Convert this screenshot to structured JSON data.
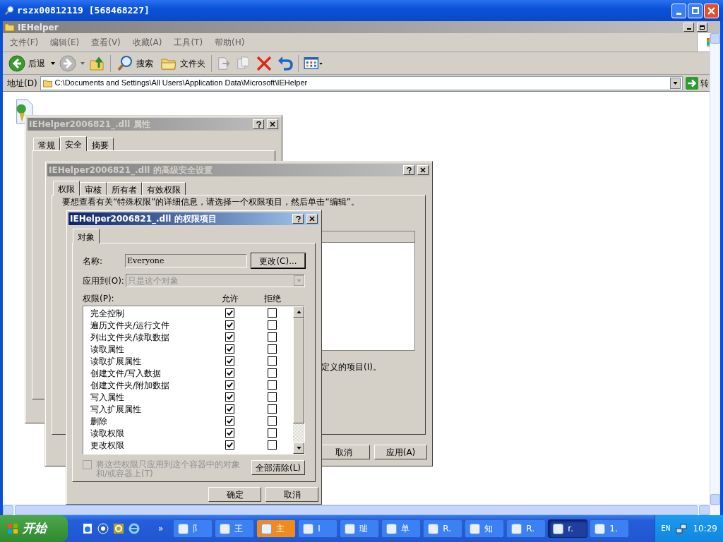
{
  "window": {
    "title": "rszx00812119 [568468227]"
  },
  "explorer": {
    "title": "IEHelper",
    "menu": [
      "文件(F)",
      "编辑(E)",
      "查看(V)",
      "收藏(A)",
      "工具(T)",
      "帮助(H)"
    ],
    "toolbar": [
      {
        "kind": "back",
        "label": "后退"
      },
      {
        "kind": "forward"
      },
      {
        "kind": "up"
      },
      {
        "kind": "search",
        "label": "搜索"
      },
      {
        "kind": "folders",
        "label": "文件夹"
      },
      {
        "kind": "move"
      },
      {
        "kind": "copy"
      },
      {
        "kind": "delete"
      },
      {
        "kind": "undo"
      },
      {
        "kind": "views"
      }
    ],
    "address": {
      "label": "地址(D)",
      "value": "C:\\Documents and Settings\\All Users\\Application Data\\Microsoft\\IEHelper",
      "go": "转"
    }
  },
  "properties_dialog": {
    "title": "IEHelper2006821_.dll 属性",
    "active": false,
    "tabs": [
      {
        "label": "常规",
        "selected": false
      },
      {
        "label": "安全",
        "selected": true
      },
      {
        "label": "摘要",
        "selected": false
      }
    ]
  },
  "advanced_dialog": {
    "title": "IEHelper2006821_.dll 的高级安全设置",
    "active": false,
    "tabs": [
      {
        "label": "权限",
        "selected": true
      },
      {
        "label": "审核",
        "selected": false
      },
      {
        "label": "所有者",
        "selected": false
      },
      {
        "label": "有效权限",
        "selected": false
      }
    ],
    "hint": "要想查看有关“特殊权限”的详细信息，请选择一个权限项目，然后单击“编辑”。",
    "note": "定义的项目(I)。",
    "buttons": [
      "取消",
      "应用(A)"
    ]
  },
  "entry_dialog": {
    "title": "IEHelper2006821_.dll 的权限项目",
    "active": true,
    "tabs": [
      {
        "label": "对象",
        "selected": true
      }
    ],
    "name_label": "名称:",
    "name_value": "Everyone",
    "change_button": "更改(C)...",
    "apply_label": "应用到(O):",
    "apply_value": "只是这个对象",
    "apply_disabled": true,
    "permissions_label": "权限(P):",
    "allow_header": "允许",
    "deny_header": "拒绝",
    "rows": [
      {
        "name": "完全控制",
        "allow": true,
        "deny": false
      },
      {
        "name": "遍历文件夹/运行文件",
        "allow": true,
        "deny": false
      },
      {
        "name": "列出文件夹/读取数据",
        "allow": true,
        "deny": false
      },
      {
        "name": "读取属性",
        "allow": true,
        "deny": false
      },
      {
        "name": "读取扩展属性",
        "allow": true,
        "deny": false
      },
      {
        "name": "创建文件/写入数据",
        "allow": true,
        "deny": false
      },
      {
        "name": "创建文件夹/附加数据",
        "allow": true,
        "deny": false
      },
      {
        "name": "写入属性",
        "allow": true,
        "deny": false
      },
      {
        "name": "写入扩展属性",
        "allow": true,
        "deny": false
      },
      {
        "name": "删除",
        "allow": true,
        "deny": false
      },
      {
        "name": "读取权限",
        "allow": true,
        "deny": false
      },
      {
        "name": "更改权限",
        "allow": true,
        "deny": false
      }
    ],
    "container_option": {
      "label": "将这些权限只应用到这个容器中的对象和/或容器上(T)",
      "checked": false,
      "disabled": true
    },
    "clear_button": "全部清除(L)",
    "buttons": [
      "确定",
      "取消"
    ]
  },
  "taskbar": {
    "start": "开始",
    "more": "»",
    "tasks": [
      {
        "label": "阝",
        "selected": false,
        "color": "#3c81f3"
      },
      {
        "label": "王",
        "selected": false,
        "color": "#3c81f3"
      },
      {
        "label": "主",
        "selected": false,
        "color": "#f08a1c"
      },
      {
        "label": "I",
        "selected": false,
        "color": "#3c81f3"
      },
      {
        "label": "琎",
        "selected": false,
        "color": "#3c81f3"
      },
      {
        "label": "单",
        "selected": false,
        "color": "#3c81f3"
      },
      {
        "label": "R.",
        "selected": false,
        "color": "#3c81f3"
      },
      {
        "label": "知",
        "selected": false,
        "color": "#3c81f3"
      },
      {
        "label": "R.",
        "selected": false,
        "color": "#3c81f3"
      },
      {
        "label": "r.",
        "selected": true,
        "color": "#1e3f9e"
      },
      {
        "label": "1.",
        "selected": false,
        "color": "#3c81f3"
      }
    ],
    "language": "EN",
    "time": "10:29"
  }
}
